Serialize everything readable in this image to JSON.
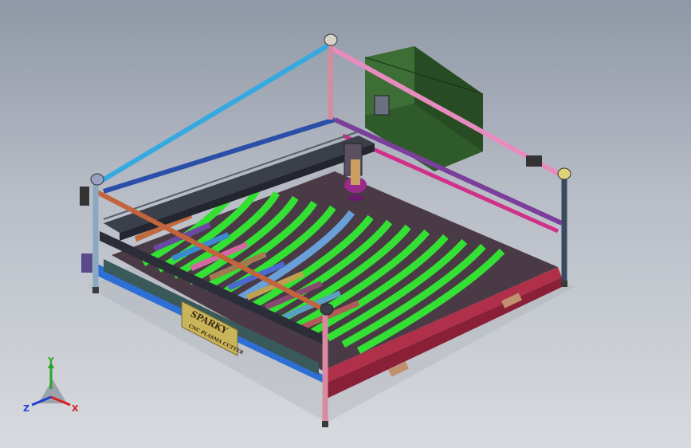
{
  "window": {
    "title": ""
  },
  "model": {
    "description_text_on_plate": {
      "line1": "SPARKY",
      "line2": "CNC PLASMA CUTTER"
    }
  },
  "triad": {
    "x_label": "X",
    "y_label": "Y",
    "z_label": "Z",
    "x_color": "#d62020",
    "y_color": "#2aa52a",
    "z_color": "#2040d0"
  },
  "colors": {
    "background_top": "#8f98a6",
    "background_bottom": "#d7dade",
    "top_rail_cyan": "#35a9e0",
    "top_rail_pink": "#e88cc0",
    "front_rail_orange": "#c4643c",
    "side_rail_blue": "#2e6fd6",
    "bed_green": "#33e033",
    "frame_red": "#b0304a",
    "frame_magenta": "#d0308a",
    "control_box": "#2f5a2a",
    "nameplate": "#c8b45a"
  }
}
